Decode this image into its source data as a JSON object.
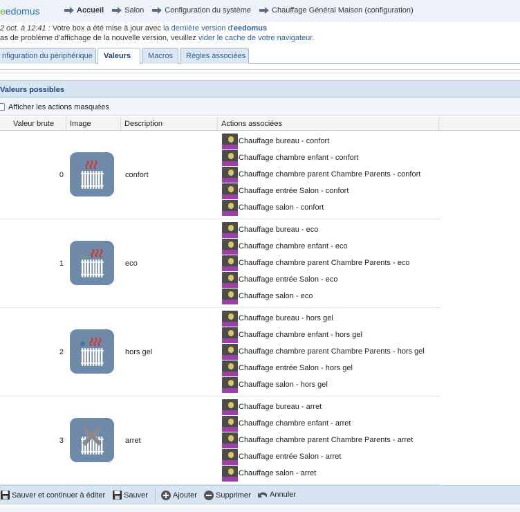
{
  "brand": {
    "logo_e": "e",
    "logo_rest": "edomus"
  },
  "breadcrumbs": [
    {
      "label": "Accueil",
      "bold": true
    },
    {
      "label": "Salon",
      "bold": false
    },
    {
      "label": "Configuration du système",
      "bold": false
    },
    {
      "label": "Chauffage Général Maison (configuration)",
      "bold": false
    }
  ],
  "notice": {
    "line1_date": "2 oct. à 12:41 :",
    "line1_text": " Votre box a été mise à jour avec ",
    "line1_link": "la dernière version d'",
    "line1_brand": "eedomus",
    "line2_text": "as de problème d'affichage de la nouvelle version, veuillez ",
    "line2_link": "vider le cache de votre navigateur",
    "line2_end": "."
  },
  "tabs": [
    {
      "label": "nfiguration du périphérique",
      "active": false
    },
    {
      "label": "Valeurs",
      "active": true
    },
    {
      "label": "Macros",
      "active": false
    },
    {
      "label": "Règles associées",
      "active": false
    }
  ],
  "section": {
    "title": "Valeurs possibles",
    "show_hidden_label": "Afficher les actions masquées"
  },
  "columns": [
    "Valeur brute",
    "Image",
    "Description",
    "Actions associées"
  ],
  "rows": [
    {
      "value": "0",
      "description": "confort",
      "icon": "radiator-confort-icon",
      "actions": [
        "Chauffage bureau - confort",
        "Chauffage chambre enfant - confort",
        "Chauffage chambre parent Chambre Parents - confort",
        "Chauffage entrée Salon - confort",
        "Chauffage salon - confort"
      ]
    },
    {
      "value": "1",
      "description": "eco",
      "icon": "radiator-eco-icon",
      "actions": [
        "Chauffage bureau - eco",
        "Chauffage chambre enfant - eco",
        "Chauffage chambre parent Chambre Parents - eco",
        "Chauffage entrée Salon - eco",
        "Chauffage salon - eco"
      ]
    },
    {
      "value": "2",
      "description": "hors gel",
      "icon": "radiator-frost-icon",
      "actions": [
        "Chauffage bureau - hors gel",
        "Chauffage chambre enfant - hors gel",
        "Chauffage chambre parent Chambre Parents - hors gel",
        "Chauffage entrée Salon - hors gel",
        "Chauffage salon - hors gel"
      ]
    },
    {
      "value": "3",
      "description": "arret",
      "icon": "radiator-off-icon",
      "actions": [
        "Chauffage bureau - arret",
        "Chauffage chambre enfant - arret",
        "Chauffage chambre parent Chambre Parents - arret",
        "Chauffage entrée Salon - arret",
        "Chauffage salon - arret"
      ]
    }
  ],
  "toolbar": {
    "save_continue": "Sauver et continuer à éditer",
    "save": "Sauver",
    "add": "Ajouter",
    "delete": "Supprimer",
    "cancel": "Annuler"
  },
  "colors": {
    "accent": "#2a5d9f",
    "header_bg": "#d7e4f1",
    "icon_bg": "#6f89a8",
    "heat_red": "#d9302a",
    "frost_blue": "#2f66b3"
  }
}
